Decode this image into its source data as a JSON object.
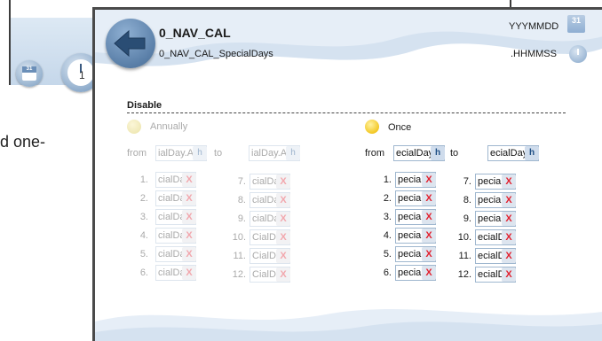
{
  "background": {
    "calendar_icon_day": "31",
    "clock_number": "1",
    "partial_text": "d one-"
  },
  "header": {
    "title": "0_NAV_CAL",
    "subtitle": "0_NAV_CAL_SpecialDays",
    "date_format": "YYYMMDD",
    "date_icon_day": "31",
    "time_format": ".HHMMSS"
  },
  "disable_label": "Disable",
  "annually": {
    "label": "Annually",
    "state": "disabled",
    "from_label": "from",
    "to_label": "to",
    "from_value": "ialDay.Ar",
    "to_value": "ialDay.Ar",
    "h_label": "h",
    "x_label": "X",
    "rows": [
      {
        "num": "1.",
        "value": "cialDay.A"
      },
      {
        "num": "2.",
        "value": "cialDay./"
      },
      {
        "num": "3.",
        "value": "cialDay./"
      },
      {
        "num": "4.",
        "value": "cialDay./"
      },
      {
        "num": "5.",
        "value": "cialDay./"
      },
      {
        "num": "6.",
        "value": "cialDay./"
      },
      {
        "num": "7.",
        "value": "cialDay./"
      },
      {
        "num": "8.",
        "value": "cialDay./"
      },
      {
        "num": "9.",
        "value": "cialDay./"
      },
      {
        "num": "10.",
        "value": "CialDay.A"
      },
      {
        "num": "11.",
        "value": "CialDay.A"
      },
      {
        "num": "12.",
        "value": "CialDay.A"
      }
    ]
  },
  "once": {
    "label": "Once",
    "state": "enabled",
    "from_label": "from",
    "to_label": "to",
    "from_value": "ecialDay.(",
    "to_value": "ecialDay.(",
    "h_label": "h",
    "x_label": "X",
    "rows": [
      {
        "num": "1.",
        "value": "pecialDay"
      },
      {
        "num": "2.",
        "value": "pecialDay"
      },
      {
        "num": "3.",
        "value": "pecialDay"
      },
      {
        "num": "4.",
        "value": "pecialDay"
      },
      {
        "num": "5.",
        "value": "pecialDay"
      },
      {
        "num": "6.",
        "value": "pecialDay"
      },
      {
        "num": "7.",
        "value": "pecialDay"
      },
      {
        "num": "8.",
        "value": "pecialDay"
      },
      {
        "num": "9.",
        "value": "pecialDay"
      },
      {
        "num": "10.",
        "value": "ecialDay"
      },
      {
        "num": "11.",
        "value": "ecialDay"
      },
      {
        "num": "12.",
        "value": "ecialDay"
      }
    ]
  },
  "colors": {
    "header_wave": "#cfdded",
    "accent_blue": "#5a7fa8",
    "active_radio": "#f3c825",
    "delete_red": "#e21f2d"
  },
  "icons": {
    "back": "back-arrow-icon",
    "date": "calendar-icon",
    "time": "clock-icon",
    "delete": "delete-x-icon"
  }
}
